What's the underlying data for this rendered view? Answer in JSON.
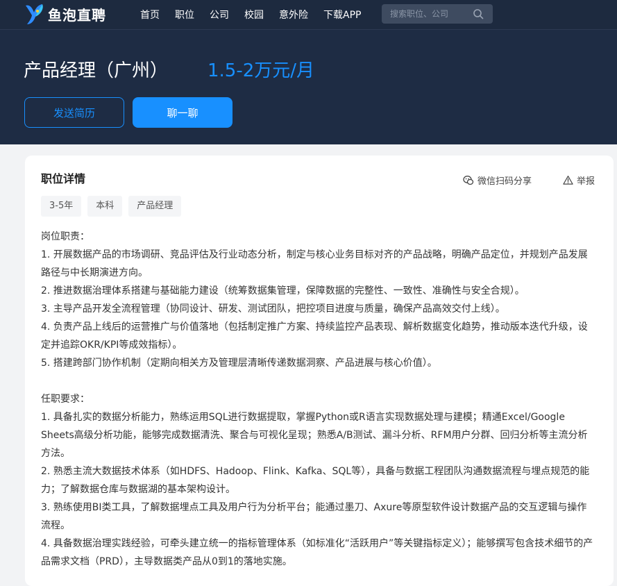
{
  "nav": {
    "brand": "鱼泡直聘",
    "links": [
      "首页",
      "职位",
      "公司",
      "校园",
      "意外险",
      "下载APP"
    ],
    "search_placeholder": "搜索职位、公司"
  },
  "job": {
    "title": "产品经理（广州）",
    "salary": "1.5-2万元/月",
    "send_resume": "发送简历",
    "chat": "聊一聊"
  },
  "detail": {
    "section_title": "职位详情",
    "share": "微信扫码分享",
    "report": "举报",
    "tags": [
      "3-5年",
      "本科",
      "产品经理"
    ],
    "responsibilities_heading": "岗位职责：",
    "responsibilities": [
      "1. 开展数据产品的市场调研、竞品评估及行业动态分析，制定与核心业务目标对齐的产品战略，明确产品定位，并规划产品发展路径与中长期演进方向。",
      "2. 推进数据治理体系搭建与基础能力建设（统筹数据集管理，保障数据的完整性、一致性、准确性与安全合规）。",
      "3. 主导产品开发全流程管理（协同设计、研发、测试团队，把控项目进度与质量，确保产品高效交付上线）。",
      "4. 负责产品上线后的运营推广与价值落地（包括制定推广方案、持续监控产品表现、解析数据变化趋势，推动版本迭代升级，设定并追踪OKR/KPI等成效指标）。",
      "5. 搭建跨部门协作机制（定期向相关方及管理层清晰传递数据洞察、产品进展与核心价值）。"
    ],
    "requirements_heading": "任职要求：",
    "requirements": [
      "1. 具备扎实的数据分析能力，熟练运用SQL进行数据提取，掌握Python或R语言实现数据处理与建模；精通Excel/Google Sheets高级分析功能，能够完成数据清洗、聚合与可视化呈现；熟悉A/B测试、漏斗分析、RFM用户分群、回归分析等主流分析方法。",
      "2. 熟悉主流大数据技术体系（如HDFS、Hadoop、Flink、Kafka、SQL等），具备与数据工程团队沟通数据流程与埋点规范的能力；了解数据仓库与数据湖的基本架构设计。",
      "3. 熟练使用BI类工具，了解数据埋点工具及用户行为分析平台；能通过墨刀、Axure等原型软件设计数据产品的交互逻辑与操作流程。",
      "4. 具备数据治理实践经验，可牵头建立统一的指标管理体系（如标准化“活跃用户”等关键指标定义）；能够撰写包含技术细节的产品需求文档（PRD），主导数据类产品从0到1的落地实施。"
    ]
  },
  "colors": {
    "nav_bg": "#1d2a3f",
    "banner_bg": "#1e2c44",
    "accent": "#1890ff",
    "page_bg": "#f2f3f5"
  },
  "icons": [
    "fish-logo-icon",
    "search-icon",
    "wechat-share-icon",
    "warning-icon"
  ]
}
